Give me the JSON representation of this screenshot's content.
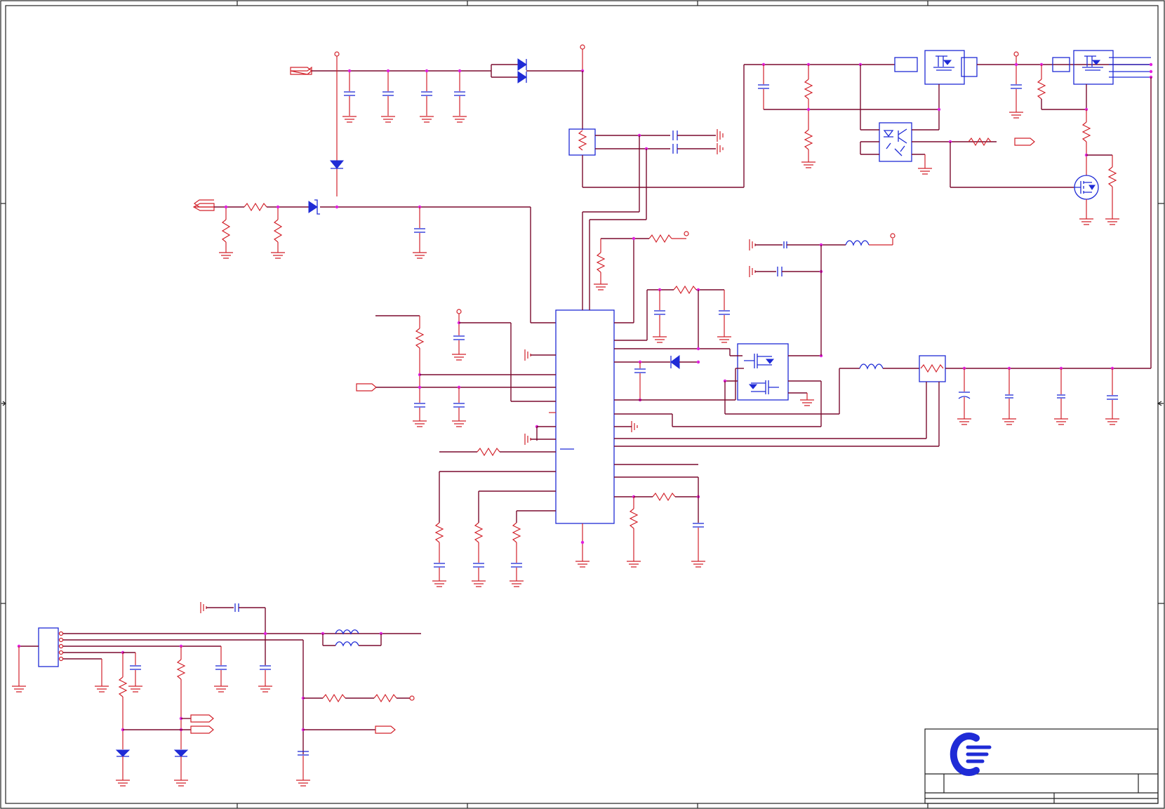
{
  "sheet": {
    "title_block": {
      "logo": "company-logo"
    }
  },
  "colors": {
    "wire": "#7a0a2e",
    "part": "#d2222b",
    "ic": "#1f2bd6",
    "junction": "#e020e0",
    "frame": "#222222"
  }
}
